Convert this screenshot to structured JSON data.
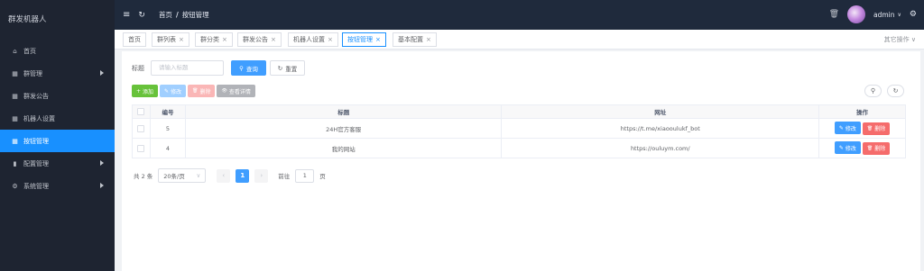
{
  "sidebar": {
    "brand": "群发机器人",
    "items": [
      {
        "label": "首页",
        "icon": "home-icon",
        "glyph": "⌂",
        "has_arrow": false,
        "active": false
      },
      {
        "label": "群管理",
        "icon": "grid-icon",
        "glyph": "▦",
        "has_arrow": true,
        "active": false
      },
      {
        "label": "群发公告",
        "icon": "grid-icon",
        "glyph": "▦",
        "has_arrow": false,
        "active": false
      },
      {
        "label": "机器人设置",
        "icon": "grid-icon",
        "glyph": "▦",
        "has_arrow": false,
        "active": false
      },
      {
        "label": "按钮管理",
        "icon": "grid-icon",
        "glyph": "▦",
        "has_arrow": false,
        "active": true
      },
      {
        "label": "配置管理",
        "icon": "bar-chart-icon",
        "glyph": "▮",
        "has_arrow": true,
        "active": false
      },
      {
        "label": "系统管理",
        "icon": "gear-icon",
        "glyph": "⚙",
        "has_arrow": true,
        "active": false
      }
    ]
  },
  "header": {
    "breadcrumb_home": "首页",
    "breadcrumb_sep": "/",
    "breadcrumb_current": "按钮管理",
    "username": "admin",
    "menu_glyph": "≡",
    "refresh_glyph": "↻",
    "trash_glyph": "🗑",
    "settings_glyph": "⚙",
    "caret_glyph": "∨"
  },
  "tabs": {
    "items": [
      {
        "label": "首页",
        "closable": false,
        "active": false
      },
      {
        "label": "群列表",
        "closable": true,
        "active": false
      },
      {
        "label": "群分类",
        "closable": true,
        "active": false
      },
      {
        "label": "群发公告",
        "closable": true,
        "active": false
      },
      {
        "label": "机器人设置",
        "closable": true,
        "active": false
      },
      {
        "label": "按钮管理",
        "closable": true,
        "active": true
      },
      {
        "label": "基本配置",
        "closable": true,
        "active": false
      }
    ],
    "close_glyph": "×",
    "closed_ops": "其它操作 ∨"
  },
  "search": {
    "label": "标题",
    "placeholder": "请输入标题",
    "search_button": "查询",
    "reset_button": "重置",
    "search_glyph": "⚲",
    "reset_glyph": "↻"
  },
  "toolbar": {
    "add": "添加",
    "edit": "修改",
    "delete": "删除",
    "detail": "查看详情",
    "add_glyph": "+",
    "edit_glyph": "✎",
    "delete_glyph": "🗑",
    "detail_glyph": "👁",
    "search_circle_glyph": "⚲",
    "refresh_circle_glyph": "↻"
  },
  "table": {
    "columns": [
      "编号",
      "标题",
      "网址",
      "操作"
    ],
    "rows": [
      {
        "id": "5",
        "title": "24H官方客服",
        "url": "https://t.me/xiaooulukf_bot"
      },
      {
        "id": "4",
        "title": "我的网站",
        "url": "https://ouluym.com/"
      }
    ],
    "edit_label": "修改",
    "delete_label": "删除"
  },
  "pager": {
    "total": "共 2 条",
    "page_size": "20条/页",
    "prev_glyph": "‹",
    "current_page": "1",
    "next_glyph": "›",
    "goto_label": "前往",
    "goto_value": "1",
    "page_suffix": "页"
  }
}
